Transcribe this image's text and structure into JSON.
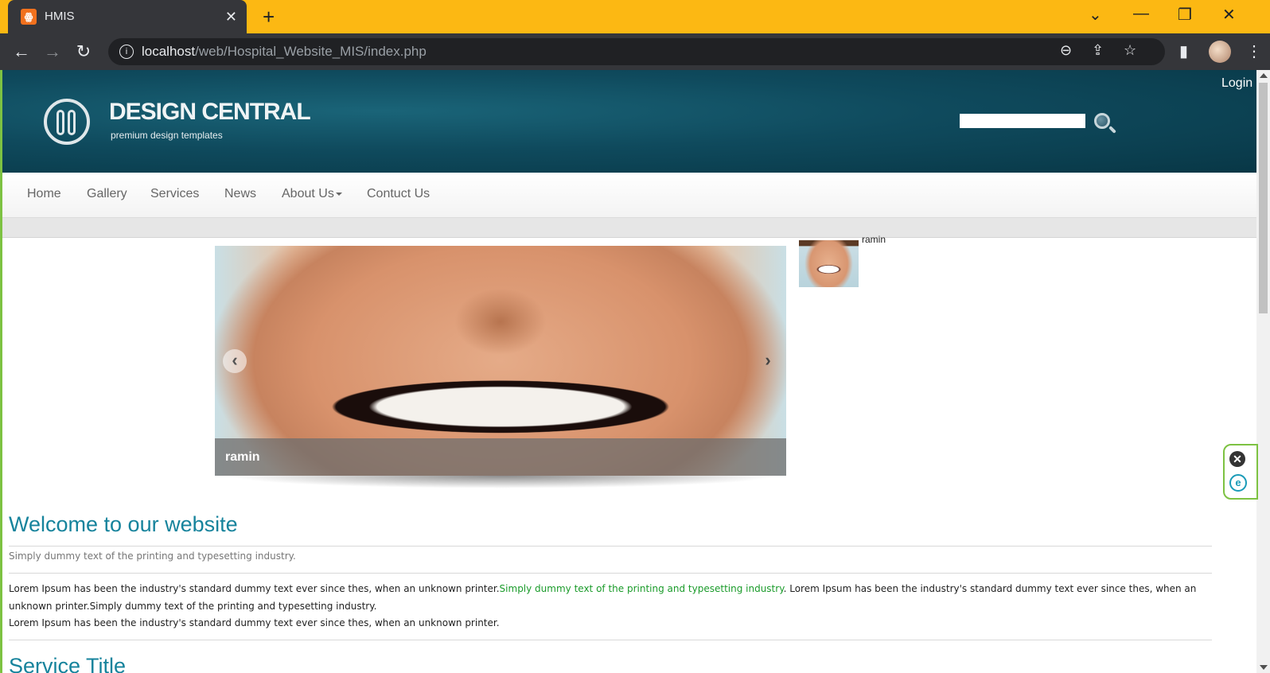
{
  "browser": {
    "tab_title": "HMIS",
    "url_host": "localhost",
    "url_path": "/web/Hospital_Website_MIS/index.php",
    "accent_color": "#fcb813",
    "frame_color": "#7dc242"
  },
  "site": {
    "logo_title": "DESIGN CENTRAL",
    "logo_subtitle": "premium design templates",
    "login_label": "Login",
    "search_placeholder": "",
    "header_color": "#0f4a5d"
  },
  "nav": {
    "items": [
      {
        "label": "Home"
      },
      {
        "label": "Gallery"
      },
      {
        "label": "Services"
      },
      {
        "label": "News"
      },
      {
        "label": "About Us"
      },
      {
        "label": "Contuct Us"
      }
    ]
  },
  "slider": {
    "caption": "ramin",
    "thumb_label": "ramin"
  },
  "content": {
    "welcome_title": "Welcome to our website",
    "lead": "Simply dummy text of the printing and typesetting industry.",
    "para1_start": "Lorem Ipsum has been the industry's standard dummy text ever since thes, when an unknown printer.",
    "para1_link": "Simply dummy text of the printing and typesetting industry",
    "para1_end": ". Lorem Ipsum has been the industry's standard dummy text ever since thes, when an unknown printer.Simply dummy text of the printing and typesetting industry.",
    "para2": "Lorem Ipsum has been the industry's standard dummy text ever since thes, when an unknown printer.",
    "next_heading": "Service Title",
    "link_color": "#1a9b2a",
    "heading_color": "#16839c"
  }
}
